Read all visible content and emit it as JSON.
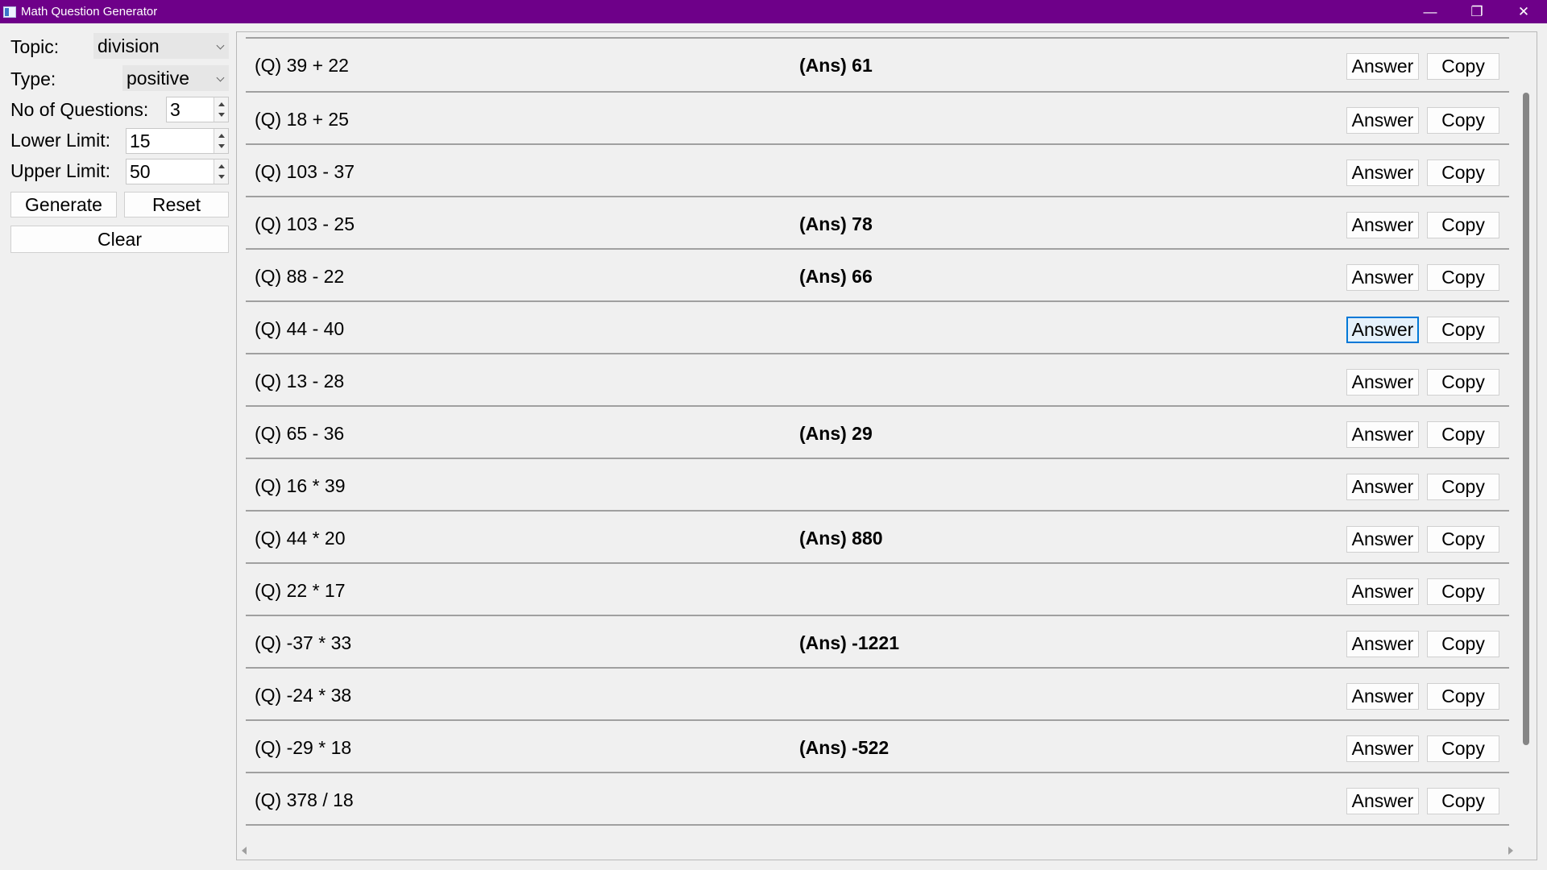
{
  "window": {
    "title": "Math Question Generator",
    "minimize_glyph": "—",
    "restore_glyph": "❐",
    "close_glyph": "✕"
  },
  "form": {
    "topic_label": "Topic:",
    "topic_value": "division",
    "type_label": "Type:",
    "type_value": "positive",
    "count_label": "No of Questions:",
    "count_value": "3",
    "lower_label": "Lower Limit:",
    "lower_value": "15",
    "upper_label": "Upper Limit:",
    "upper_value": "50",
    "generate_label": "Generate",
    "reset_label": "Reset",
    "clear_label": "Clear"
  },
  "buttons": {
    "answer_label": "Answer",
    "copy_label": "Copy"
  },
  "questions": [
    {
      "q": "(Q) 39 + 22",
      "ans": "(Ans) 61"
    },
    {
      "q": "(Q) 18 + 25",
      "ans": ""
    },
    {
      "q": "(Q) 103 - 37",
      "ans": ""
    },
    {
      "q": "(Q) 103 - 25",
      "ans": "(Ans) 78"
    },
    {
      "q": "(Q) 88 - 22",
      "ans": "(Ans) 66"
    },
    {
      "q": "(Q) 44 - 40",
      "ans": "",
      "focused": true
    },
    {
      "q": "(Q) 13 - 28",
      "ans": ""
    },
    {
      "q": "(Q) 65 - 36",
      "ans": "(Ans) 29"
    },
    {
      "q": "(Q) 16 * 39",
      "ans": ""
    },
    {
      "q": "(Q) 44 * 20",
      "ans": "(Ans) 880"
    },
    {
      "q": "(Q) 22 * 17",
      "ans": ""
    },
    {
      "q": "(Q) -37 * 33",
      "ans": "(Ans) -1221"
    },
    {
      "q": "(Q) -24 * 38",
      "ans": ""
    },
    {
      "q": "(Q) -29 * 18",
      "ans": "(Ans) -522"
    },
    {
      "q": "(Q) 378 / 18",
      "ans": ""
    }
  ],
  "colors": {
    "titlebar": "#6e0089",
    "focus_border": "#0078d7"
  }
}
